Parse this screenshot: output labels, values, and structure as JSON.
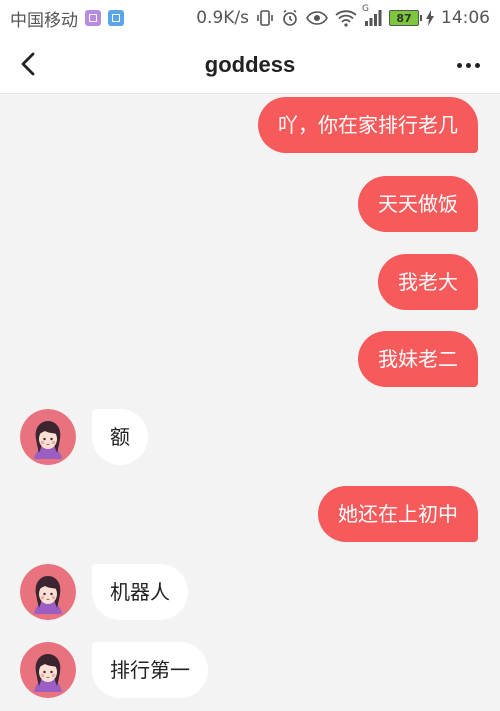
{
  "status_bar": {
    "carrier": "中国移动",
    "speed": "0.9K/s",
    "network": "G",
    "battery": "87",
    "time": "14:06"
  },
  "header": {
    "title": "goddess"
  },
  "messages": [
    {
      "side": "out",
      "text": "吖，你在家排行老几"
    },
    {
      "side": "out",
      "text": "天天做饭"
    },
    {
      "side": "out",
      "text": "我老大"
    },
    {
      "side": "out",
      "text": "我妹老二"
    },
    {
      "side": "in",
      "text": "额"
    },
    {
      "side": "out",
      "text": "她还在上初中"
    },
    {
      "side": "in",
      "text": "机器人"
    },
    {
      "side": "in",
      "text": "排行第一"
    }
  ],
  "colors": {
    "outgoing_bubble": "#f65a5b",
    "background": "#f3f3f3",
    "avatar_bg": "#e8737e"
  }
}
